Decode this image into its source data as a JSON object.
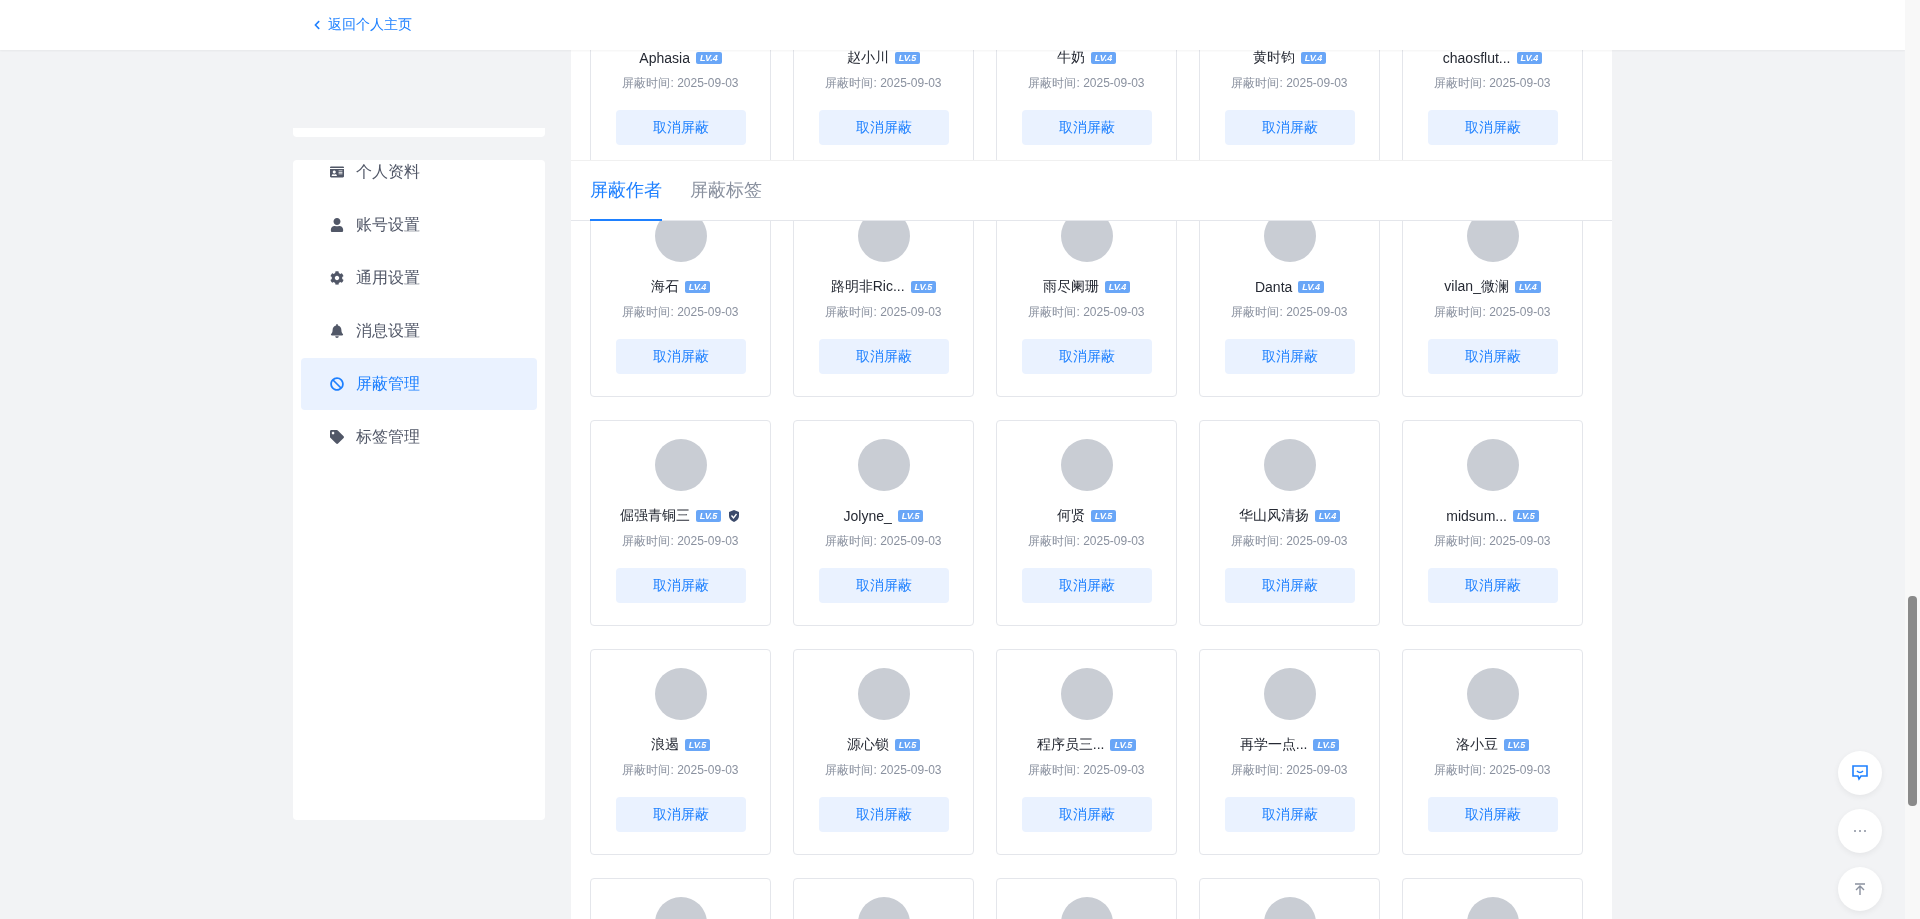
{
  "header": {
    "back_link": "返回个人主页"
  },
  "sidebar": {
    "items": [
      {
        "label": "个人资料",
        "selected": false
      },
      {
        "label": "账号设置",
        "selected": false
      },
      {
        "label": "通用设置",
        "selected": false
      },
      {
        "label": "消息设置",
        "selected": false
      },
      {
        "label": "屏蔽管理",
        "selected": true
      },
      {
        "label": "标签管理",
        "selected": false
      }
    ]
  },
  "previous_row": [
    {
      "name": "Aphasia",
      "level_badge": "LV.4",
      "certified": false,
      "time": "屏蔽时间: 2025-09-03",
      "button": "取消屏蔽"
    },
    {
      "name": "赵小川",
      "level_badge": "LV.5",
      "certified": false,
      "time": "屏蔽时间: 2025-09-03",
      "button": "取消屏蔽"
    },
    {
      "name": "牛奶",
      "level_badge": "LV.4",
      "certified": false,
      "time": "屏蔽时间: 2025-09-03",
      "button": "取消屏蔽"
    },
    {
      "name": "黄时钧",
      "level_badge": "LV.4",
      "certified": false,
      "time": "屏蔽时间: 2025-09-03",
      "button": "取消屏蔽"
    },
    {
      "name": "chaosflut...",
      "level_badge": "LV.4",
      "certified": false,
      "time": "屏蔽时间: 2025-09-03",
      "button": "取消屏蔽"
    }
  ],
  "tabs": [
    {
      "label": "屏蔽作者",
      "selected": true
    },
    {
      "label": "屏蔽标签",
      "selected": false
    }
  ],
  "blocked_authors": [
    {
      "name": "海石",
      "level_badge": "LV.4",
      "certified": false,
      "time": "屏蔽时间: 2025-09-03",
      "button": "取消屏蔽"
    },
    {
      "name": "路明非Ric...",
      "level_badge": "LV.5",
      "certified": false,
      "time": "屏蔽时间: 2025-09-03",
      "button": "取消屏蔽"
    },
    {
      "name": "雨尽阑珊",
      "level_badge": "LV.4",
      "certified": false,
      "time": "屏蔽时间: 2025-09-03",
      "button": "取消屏蔽"
    },
    {
      "name": "Danta",
      "level_badge": "LV.4",
      "certified": false,
      "time": "屏蔽时间: 2025-09-03",
      "button": "取消屏蔽"
    },
    {
      "name": "vilan_微澜",
      "level_badge": "LV.4",
      "certified": false,
      "time": "屏蔽时间: 2025-09-03",
      "button": "取消屏蔽"
    },
    {
      "name": "倔强青铜三",
      "level_badge": "LV.5",
      "certified": true,
      "time": "屏蔽时间: 2025-09-03",
      "button": "取消屏蔽"
    },
    {
      "name": "Jolyne_",
      "level_badge": "LV.5",
      "certified": false,
      "time": "屏蔽时间: 2025-09-03",
      "button": "取消屏蔽"
    },
    {
      "name": "何贤",
      "level_badge": "LV.5",
      "certified": false,
      "time": "屏蔽时间: 2025-09-03",
      "button": "取消屏蔽"
    },
    {
      "name": "华山风清扬",
      "level_badge": "LV.4",
      "certified": false,
      "time": "屏蔽时间: 2025-09-03",
      "button": "取消屏蔽"
    },
    {
      "name": "midsum...",
      "level_badge": "LV.5",
      "certified": false,
      "time": "屏蔽时间: 2025-09-03",
      "button": "取消屏蔽"
    },
    {
      "name": "浪遏",
      "level_badge": "LV.5",
      "certified": false,
      "time": "屏蔽时间: 2025-09-03",
      "button": "取消屏蔽"
    },
    {
      "name": "源心锁",
      "level_badge": "LV.5",
      "certified": false,
      "time": "屏蔽时间: 2025-09-03",
      "button": "取消屏蔽"
    },
    {
      "name": "程序员三...",
      "level_badge": "LV.5",
      "certified": false,
      "time": "屏蔽时间: 2025-09-03",
      "button": "取消屏蔽"
    },
    {
      "name": "再学一点...",
      "level_badge": "LV.5",
      "certified": false,
      "time": "屏蔽时间: 2025-09-03",
      "button": "取消屏蔽"
    },
    {
      "name": "洛小豆",
      "level_badge": "LV.5",
      "certified": false,
      "time": "屏蔽时间: 2025-09-03",
      "button": "取消屏蔽"
    }
  ],
  "floating_buttons": [
    {
      "kind": "feedback"
    },
    {
      "kind": "more"
    },
    {
      "kind": "top"
    }
  ]
}
